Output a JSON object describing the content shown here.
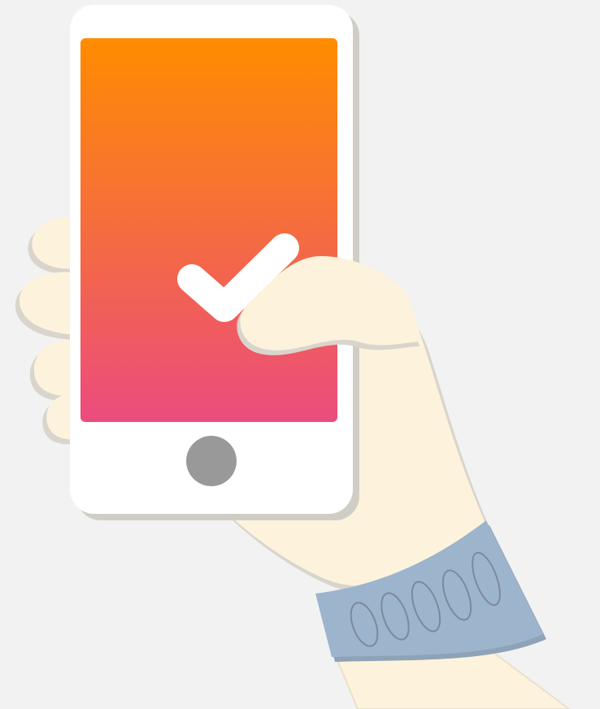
{
  "scene": {
    "background_color": "#f2f2f2",
    "skin_color": "#fdf3dc",
    "skin_shadow_color": "#d9d5cc",
    "sleeve_color": "#9db4cd",
    "sleeve_line_color": "#7a8a9a",
    "phone_body_color": "#ffffff",
    "phone_shadow_color": "#d0cdc6",
    "screen_gradient_top": "#ff8c00",
    "screen_gradient_bottom": "#eb4c7e",
    "home_button_color": "#999999",
    "checkmark_color": "#ffffff",
    "icons": [
      "hand-illustration",
      "smartphone-illustration",
      "checkmark-icon",
      "home-button-icon",
      "sleeve-cuff-illustration"
    ]
  }
}
